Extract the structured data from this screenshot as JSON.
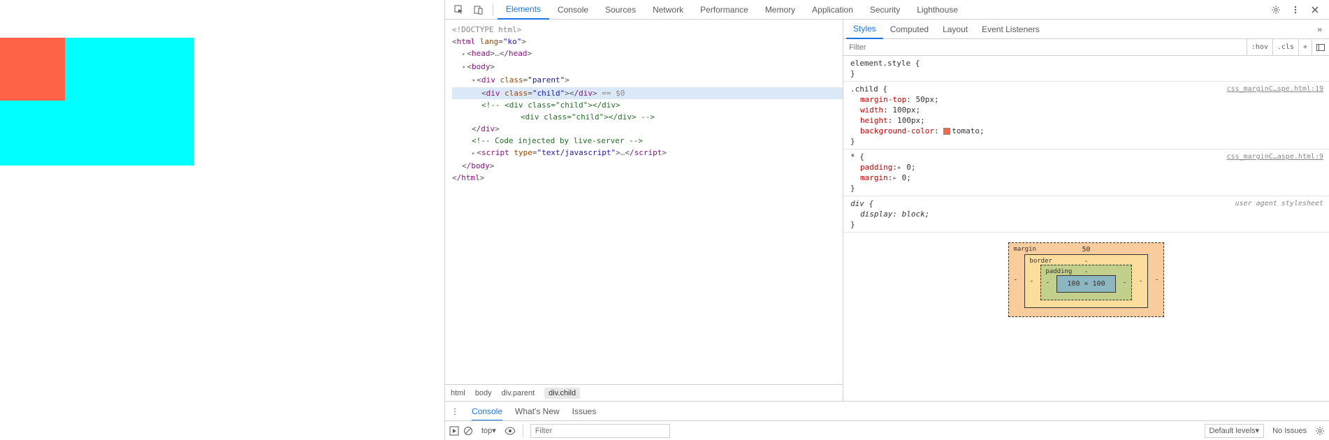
{
  "tabs": {
    "elements": "Elements",
    "console": "Console",
    "sources": "Sources",
    "network": "Network",
    "performance": "Performance",
    "memory": "Memory",
    "application": "Application",
    "security": "Security",
    "lighthouse": "Lighthouse"
  },
  "dom": {
    "doctype": "<!DOCTYPE html>",
    "html_open": "html",
    "lang_attr": "lang",
    "lang_val": "\"ko\"",
    "head_o": "head",
    "head_c": "/head",
    "ell": "…",
    "body_o": "body",
    "body_c": "/body",
    "div": "div",
    "class_attr": "class",
    "parent_val": "\"parent\"",
    "child_val": "\"child\"",
    "close_div": "/div",
    "eq0": " == $0",
    "comment1": "<!-- <div class=\"child\"></div>",
    "comment2": "<div class=\"child\"></div> -->",
    "comment3": "<!-- Code injected by live-server -->",
    "script": "script",
    "type_attr": "type",
    "type_val": "\"text/javascript\"",
    "close_script": "/script",
    "html_c": "/html"
  },
  "crumbs": {
    "html": "html",
    "body": "body",
    "parent": "div.parent",
    "child": "div.child"
  },
  "sp_tabs": {
    "styles": "Styles",
    "computed": "Computed",
    "layout": "Layout",
    "listeners": "Event Listeners"
  },
  "filter_placeholder": "Filter",
  "hov": ":hov",
  "cls": ".cls",
  "rules": {
    "elstyle": "element.style {",
    "child_sel": ".child {",
    "src1": "css_marginC…spe.html:19",
    "mt": "margin-top",
    "mtv": "50px;",
    "w": "width",
    "wv": "100px;",
    "h": "height",
    "hv": "100px;",
    "bg": "background-color",
    "bgv": "tomato;",
    "star_sel": "* {",
    "src2": "css_marginC…aspe.html:9",
    "pad": "padding",
    "padv": "0;",
    "mar": "margin",
    "marv": "0;",
    "tri": "▸ ",
    "div_sel": "div {",
    "ua": "user agent stylesheet",
    "disp": "display",
    "dispv": "block;",
    "close": "}"
  },
  "bm": {
    "margin": "margin",
    "border": "border",
    "padding": "padding",
    "top": "50",
    "dash": "-",
    "content": "100 × 100"
  },
  "console_tabs": {
    "console": "Console",
    "whatsnew": "What's New",
    "issues": "Issues"
  },
  "console_tools": {
    "top": "top",
    "filter": "Filter",
    "levels": "Default levels",
    "noissues": "No Issues"
  }
}
